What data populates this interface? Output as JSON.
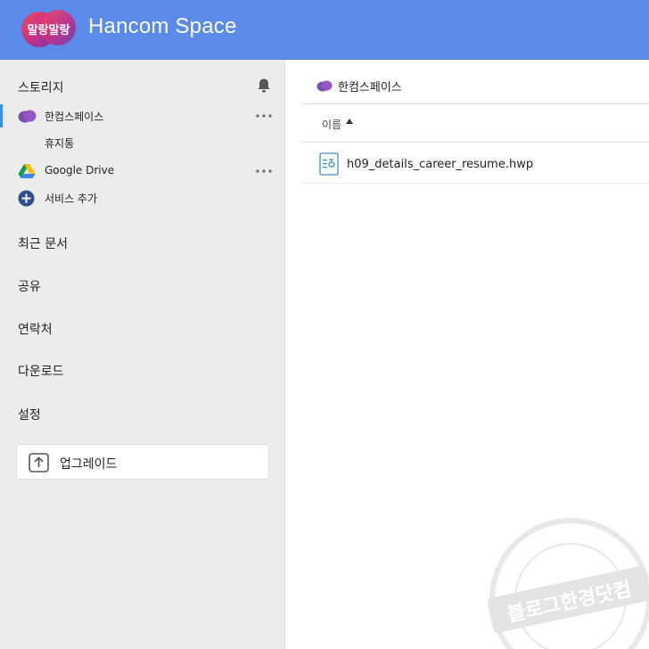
{
  "header": {
    "logo_text": "말랑말랑",
    "app_title": "Hancom Space"
  },
  "sidebar": {
    "storage_header": "스토리지",
    "storage_items": [
      {
        "label": "한컴스페이스",
        "active": true,
        "icon": "cloud-icon"
      },
      {
        "label": "휴지통",
        "active": false
      },
      {
        "label": "Google Drive",
        "active": false,
        "icon": "google-drive-icon"
      },
      {
        "label": "서비스 추가",
        "active": false,
        "icon": "add-service-icon"
      }
    ],
    "nav_items": [
      "최근 문서",
      "공유",
      "연락처",
      "다운로드",
      "설정"
    ],
    "upgrade_label": "업그레이드"
  },
  "main": {
    "breadcrumb": "한컴스페이스",
    "column_name": "이름",
    "files": [
      {
        "name": "h09_details_career_resume.hwp",
        "icon": "hwp-file-icon"
      }
    ]
  },
  "watermark": {
    "text": "블로그한경닷컴"
  },
  "colors": {
    "header_bg": "#5b8bea",
    "sidebar_bg": "#ececec",
    "active_bar": "#3c8fe6",
    "hancom_purple": "#7b4fb0",
    "add_button": "#2f4f8f"
  }
}
